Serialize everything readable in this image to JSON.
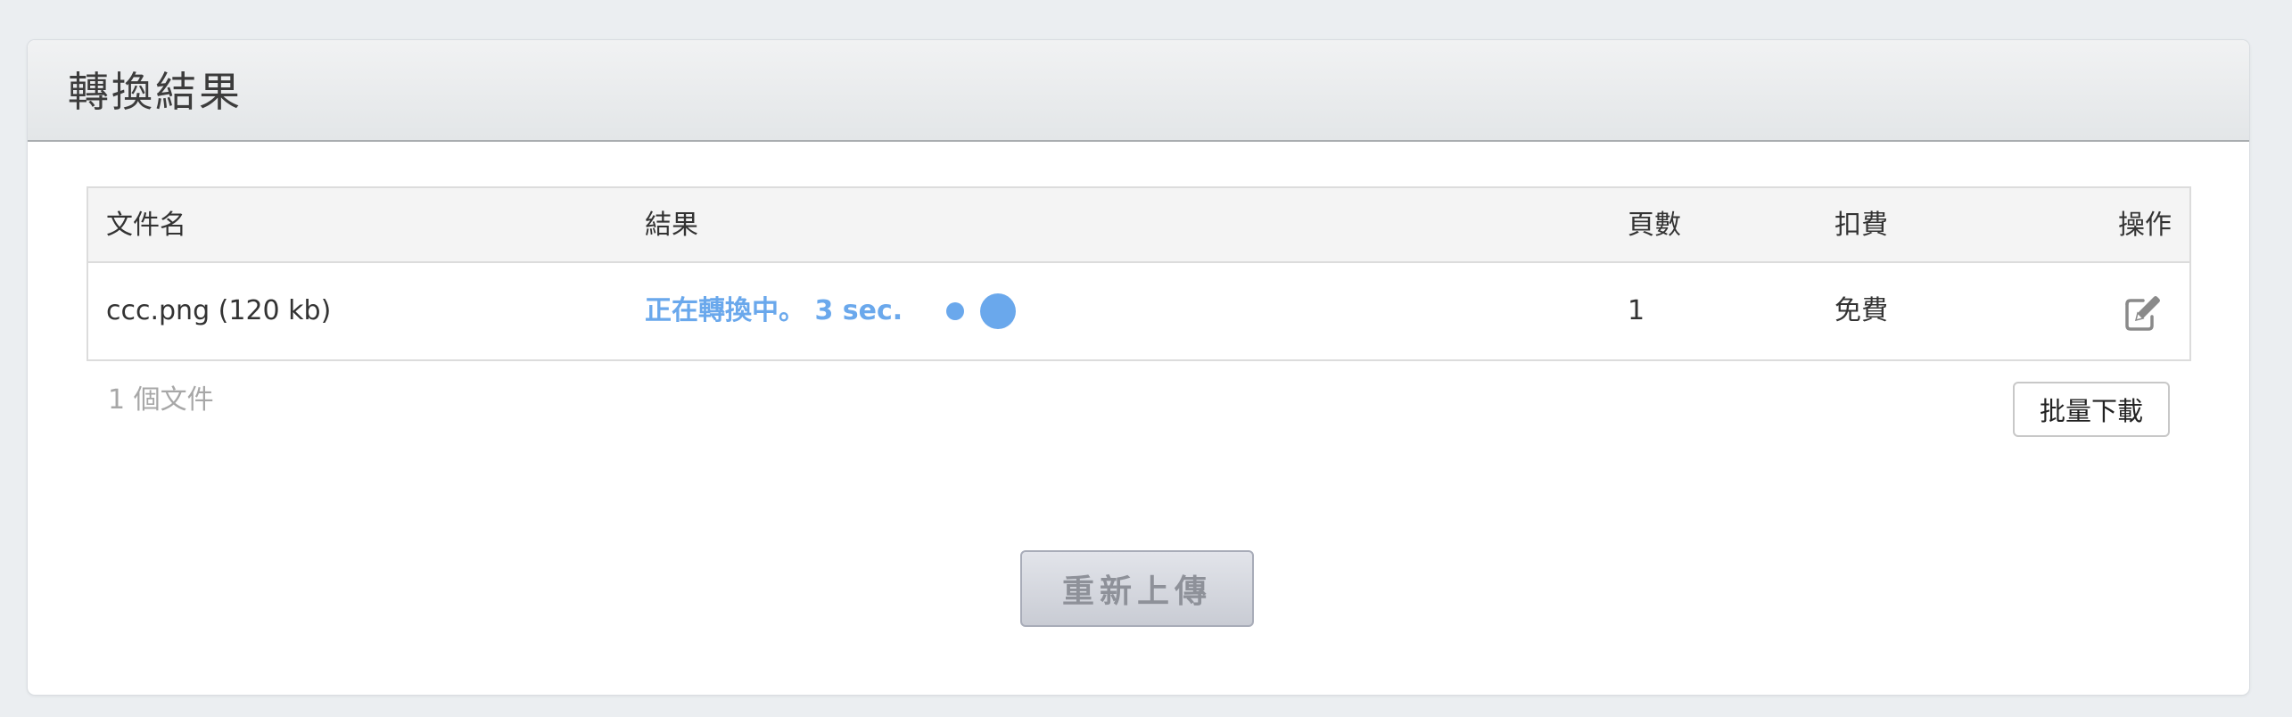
{
  "panel": {
    "title": "轉換結果"
  },
  "table": {
    "headers": {
      "name": "文件名",
      "result": "結果",
      "pages": "頁數",
      "fee": "扣費",
      "operation": "操作"
    },
    "rows": [
      {
        "name": "ccc.png (120 kb)",
        "status": "正在轉換中。 3 sec.",
        "pages": "1",
        "fee": "免費",
        "operation_icon": "edit-icon"
      }
    ]
  },
  "footer": {
    "file_count": "1 個文件",
    "batch_download_label": "批量下載",
    "reupload_label": "重新上傳"
  },
  "colors": {
    "accent": "#6aa8ec",
    "background": "#ebeef1",
    "header_bg": "#e6e8ea"
  }
}
